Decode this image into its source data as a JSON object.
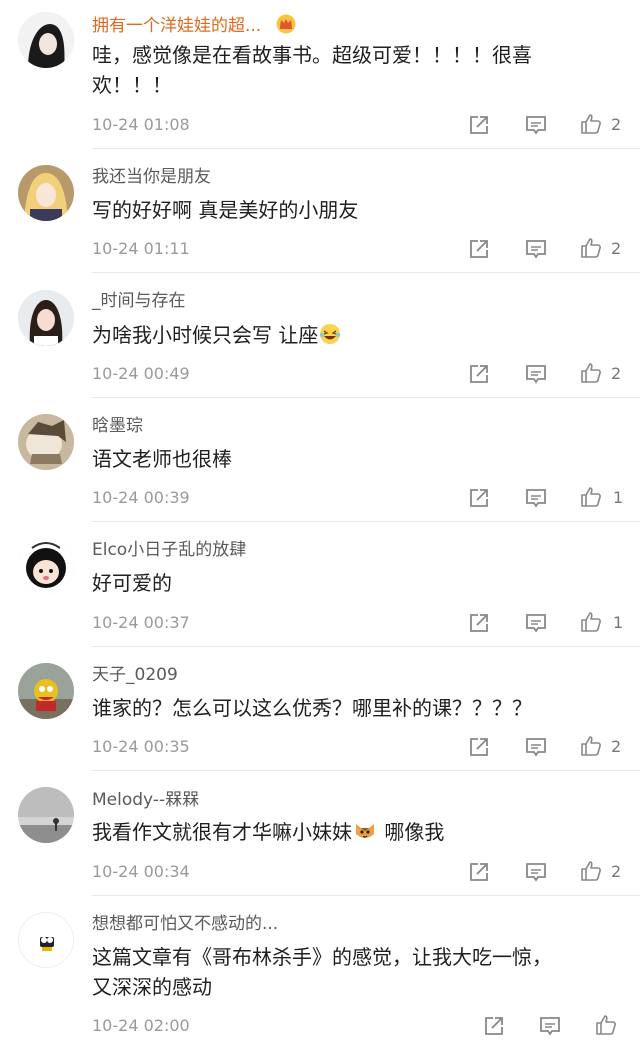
{
  "comments": [
    {
      "user": "拥有一个洋娃娃的超...",
      "lines": [
        "哇，感觉像是在看故事书。超级可爱！！！！很喜",
        "欢！！！"
      ],
      "time": "10-24 01:08",
      "likes": "2"
    },
    {
      "user": "我还当你是朋友",
      "lines": [
        "写的好好啊 真是美好的小朋友"
      ],
      "time": "10-24 01:11",
      "likes": "2"
    },
    {
      "user": "_时间与存在",
      "lines": [
        "为啥我小时候只会写 让座"
      ],
      "time": "10-24 00:49",
      "likes": "2"
    },
    {
      "user": "晗墨琮",
      "lines": [
        "语文老师也很棒"
      ],
      "time": "10-24 00:39",
      "likes": "1"
    },
    {
      "user": "Elco小日子乱的放肆",
      "lines": [
        "好可爱的"
      ],
      "time": "10-24 00:37",
      "likes": "1"
    },
    {
      "user": "天子_0209",
      "lines": [
        "谁家的？怎么可以这么优秀？哪里补的课？？？？"
      ],
      "time": "10-24 00:35",
      "likes": "2"
    },
    {
      "user": "Melody--槑槑",
      "lines": [
        "我看作文就很有才华嘛小妹妹",
        "哪像我"
      ],
      "time": "10-24 00:34",
      "likes": "2"
    },
    {
      "user": "想想都可怕又不感动的...",
      "lines": [
        "这篇文章有《哥布林杀手》的感觉，让我大吃一惊，",
        "又深深的感动"
      ],
      "time": "10-24 02:00",
      "likes": ""
    }
  ],
  "icons": {
    "crown": "crown-icon",
    "laugh_emoji": "laughing-emoji-icon",
    "cat_emoji": "cat-emoji-icon",
    "share": "share-icon",
    "reply": "comment-icon",
    "like": "thumbs-up-icon"
  },
  "colors": {
    "vip_name": "#e36a1d",
    "name": "#5a5a5a",
    "time": "#9a9a9a",
    "divider": "#e9e9e9"
  }
}
